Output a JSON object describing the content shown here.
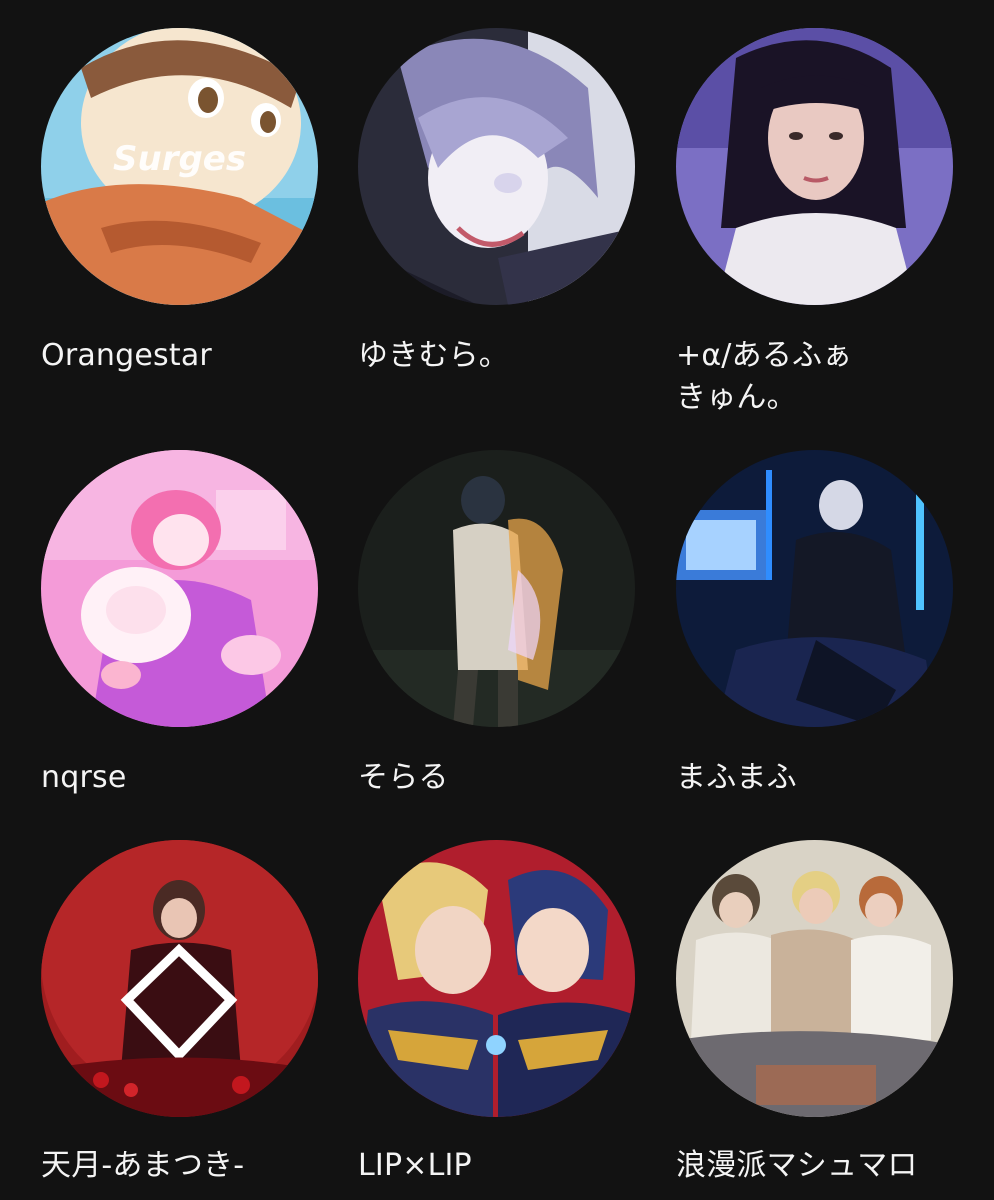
{
  "artists": [
    {
      "name": "Orangestar",
      "overlay": "Surges"
    },
    {
      "name": "ゆきむら。"
    },
    {
      "name": "+α/あるふぁ\nきゅん。"
    },
    {
      "name": "nqrse"
    },
    {
      "name": "そらる"
    },
    {
      "name": "まふまふ"
    },
    {
      "name": "天月-あまつき-"
    },
    {
      "name": "LIP×LIP"
    },
    {
      "name": "浪漫派マシュマロ"
    }
  ]
}
